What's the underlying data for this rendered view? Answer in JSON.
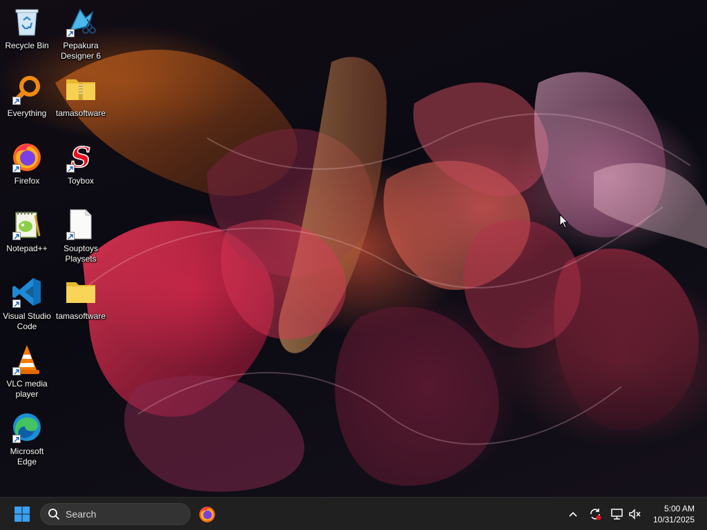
{
  "desktop": {
    "icons": [
      {
        "label": "Recycle Bin",
        "icon": "recycle-bin-icon"
      },
      {
        "label": "Pepakura Designer 6",
        "icon": "pepakura-icon"
      },
      {
        "label": "Everything",
        "icon": "everything-search-icon"
      },
      {
        "label": "tamasoftware",
        "icon": "zip-folder-icon"
      },
      {
        "label": "Firefox",
        "icon": "firefox-icon"
      },
      {
        "label": "Toybox",
        "icon": "toybox-icon"
      },
      {
        "label": "Notepad++",
        "icon": "notepad-plus-plus-icon"
      },
      {
        "label": "Souptoys Playsets",
        "icon": "blank-file-icon"
      },
      {
        "label": "Visual Studio Code",
        "icon": "vscode-icon"
      },
      {
        "label": "tamasoftware",
        "icon": "folder-icon"
      },
      {
        "label": "VLC media player",
        "icon": "vlc-icon"
      },
      {
        "label": "Microsoft Edge",
        "icon": "edge-icon"
      }
    ]
  },
  "taskbar": {
    "search_placeholder": "Search",
    "pinned_apps": [
      "firefox-icon"
    ],
    "tray_icons": [
      "chevron-up-icon",
      "sync-alert-icon",
      "network-icon",
      "volume-muted-icon"
    ],
    "time": "5:00 AM",
    "date": "10/31/2025"
  },
  "colors": {
    "taskbar_bg": "#202020",
    "search_bg": "#333333",
    "start_blue": "#3aa0f0"
  }
}
